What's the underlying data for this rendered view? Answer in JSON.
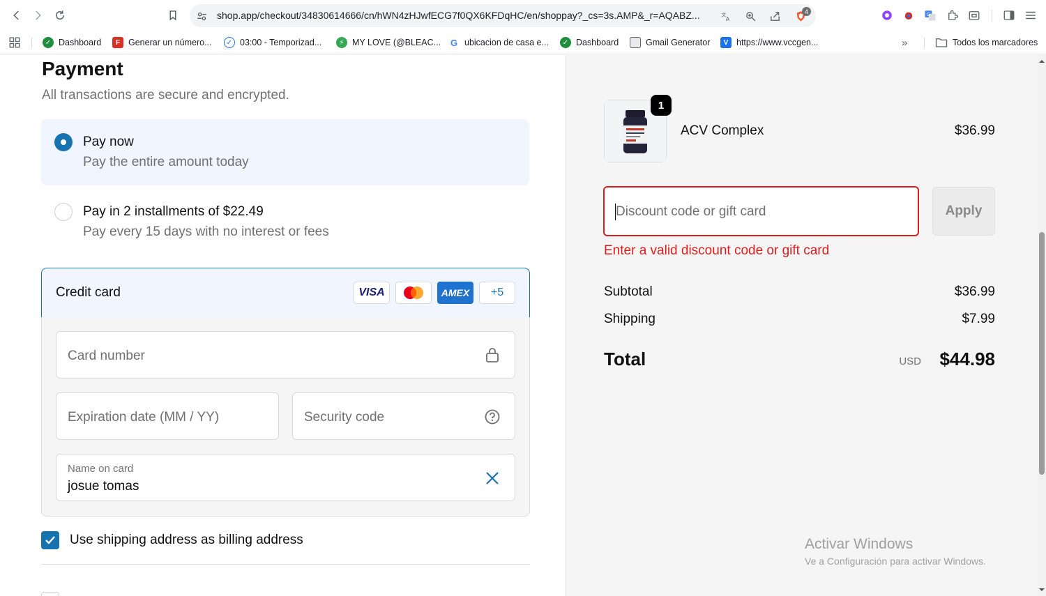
{
  "browser": {
    "url": "shop.app/checkout/34830614666/cn/hWN4zHJwfECG7f0QX6KFDqHC/en/shoppay?_cs=3s.AMP&_r=AQABZ...",
    "shields_count": "4"
  },
  "bookmarks": [
    {
      "label": "Dashboard",
      "icon": "dashboard-icon",
      "color": "#1e8e3e"
    },
    {
      "label": "Generar un número...",
      "icon": "f-icon",
      "color": "#d93025"
    },
    {
      "label": "03:00 - Temporizad...",
      "icon": "timer-check-icon",
      "color": "#1a73e8"
    },
    {
      "label": "MY LOVE (@BLEAC...",
      "icon": "bolt-icon",
      "color": "#34a853"
    },
    {
      "label": "ubicacion de casa e...",
      "icon": "google-icon",
      "color": "#4285f4"
    },
    {
      "label": "Dashboard",
      "icon": "dashboard-icon",
      "color": "#1e8e3e"
    },
    {
      "label": "Gmail Generator",
      "icon": "gmail-generator-icon",
      "color": "#5f6368"
    },
    {
      "label": "https://www.vccgen...",
      "icon": "v-icon",
      "color": "#1a73e8"
    }
  ],
  "all_bookmarks_label": "Todos los marcadores",
  "payment": {
    "title": "Payment",
    "subtitle": "All transactions are secure and encrypted.",
    "pay_now_title": "Pay now",
    "pay_now_sub": "Pay the entire amount today",
    "installments_title": "Pay in 2 installments of $22.49",
    "installments_sub": "Pay every 15 days with no interest or fees",
    "credit_card_title": "Credit card",
    "brands": [
      "VISA",
      "Mastercard",
      "AMEX",
      "+5"
    ],
    "card_number_placeholder": "Card number",
    "expiry_placeholder": "Expiration date (MM / YY)",
    "security_placeholder": "Security code",
    "name_label": "Name on card",
    "name_value": "josue tomas",
    "billing_label": "Use shipping address as billing address"
  },
  "summary": {
    "quantity": "1",
    "product_name": "ACV Complex",
    "product_price": "$36.99",
    "discount_placeholder": "Discount code or gift card",
    "apply_label": "Apply",
    "discount_error": "Enter a valid discount code or gift card",
    "subtotal_label": "Subtotal",
    "subtotal_value": "$36.99",
    "shipping_label": "Shipping",
    "shipping_value": "$7.99",
    "total_label": "Total",
    "total_currency": "USD",
    "total_value": "$44.98"
  },
  "watermark": {
    "line1": "Activar Windows",
    "line2": "Ve a Configuración para activar Windows."
  },
  "colors": {
    "accent": "#1773b0",
    "error": "#dd1d1d",
    "selected_bg": "#f0f5ff"
  }
}
